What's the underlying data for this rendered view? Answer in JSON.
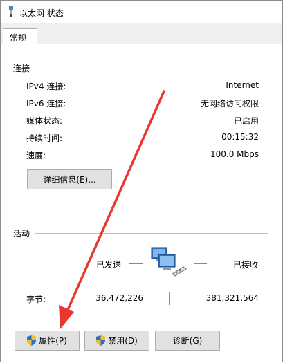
{
  "window": {
    "title": "以太网 状态"
  },
  "tabs": [
    {
      "label": "常规"
    }
  ],
  "connection": {
    "group_label": "连接",
    "rows": [
      {
        "label": "IPv4 连接:",
        "value": "Internet"
      },
      {
        "label": "IPv6 连接:",
        "value": "无网络访问权限"
      },
      {
        "label": "媒体状态:",
        "value": "已启用"
      },
      {
        "label": "持续时间:",
        "value": "00:15:32"
      },
      {
        "label": "速度:",
        "value": "100.0 Mbps"
      }
    ],
    "details_button": "详细信息(E)..."
  },
  "activity": {
    "group_label": "活动",
    "sent_label": "已发送",
    "received_label": "已接收",
    "bytes_label": "字节:",
    "bytes_sent": "36,472,226",
    "bytes_received": "381,321,564"
  },
  "buttons": {
    "properties": "属性(P)",
    "disable": "禁用(D)",
    "diagnose": "诊断(G)"
  },
  "colors": {
    "annotation_arrow": "#e8372f",
    "shield_blue": "#2a6fc9",
    "shield_yellow": "#f4c21b"
  }
}
